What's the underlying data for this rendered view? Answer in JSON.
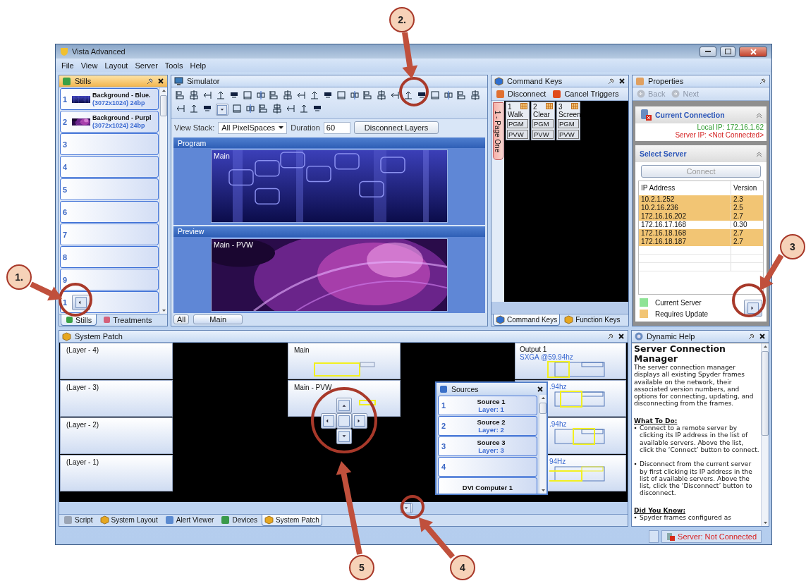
{
  "window": {
    "title": "Vista Advanced"
  },
  "menu": [
    "File",
    "View",
    "Layout",
    "Server",
    "Tools",
    "Help"
  ],
  "stills": {
    "title": "Stills",
    "items": [
      {
        "number": "1",
        "name": "Background - Blue.",
        "detail": "(3072x1024) 24bp"
      },
      {
        "number": "2",
        "name": "Background - Purpl",
        "detail": "(3072x1024) 24bp"
      },
      {
        "number": "3",
        "kind": "empty"
      },
      {
        "number": "4",
        "kind": "empty"
      },
      {
        "number": "5",
        "kind": "empty"
      },
      {
        "number": "6",
        "kind": "empty"
      },
      {
        "number": "7",
        "kind": "empty"
      },
      {
        "number": "8",
        "kind": "empty"
      },
      {
        "number": "9",
        "kind": "empty"
      },
      {
        "number": "1",
        "kind": "empty"
      }
    ],
    "tabs": [
      {
        "label": "Stills",
        "selected": true
      },
      {
        "label": "Treatments",
        "selected": false
      }
    ]
  },
  "simulator": {
    "title": "Simulator",
    "view_stack_label": "View Stack:",
    "view_stack": "All PixelSpaces",
    "duration_label": "Duration",
    "duration": "60",
    "disconnect_button": "Disconnect Layers",
    "sections": [
      {
        "title": "Program",
        "caption": "Main",
        "kind": "blue"
      },
      {
        "title": "Preview",
        "caption": "Main - PVW",
        "kind": "purple"
      }
    ],
    "filters": [
      {
        "label": "All",
        "selected": false
      },
      {
        "label": "Main",
        "selected": true
      }
    ]
  },
  "command_keys": {
    "title": "Command Keys",
    "toolbar": [
      "Disconnect",
      "Cancel Triggers"
    ],
    "page_tab": "1 - Page One",
    "keys": [
      {
        "number": "1",
        "name": "Walk",
        "buttons": [
          "PGM",
          "PVW"
        ]
      },
      {
        "number": "2",
        "name": "Clear",
        "buttons": [
          "PGM",
          "PVW"
        ]
      },
      {
        "number": "3",
        "name": "Screen",
        "buttons": [
          "PGM",
          "PVW"
        ]
      }
    ],
    "tabs": [
      {
        "label": "Command Keys",
        "selected": true
      },
      {
        "label": "Function Keys",
        "selected": false
      }
    ]
  },
  "properties": {
    "title": "Properties",
    "nav": [
      {
        "label": "Back",
        "disabled": true
      },
      {
        "label": "Next",
        "disabled": true
      }
    ],
    "current_connection": {
      "title": "Current Connection",
      "local_ip": "Local IP: 172.16.1.62",
      "server_ip": "Server IP: <Not Connected>"
    },
    "select_server": {
      "title": "Select Server",
      "connect": {
        "label": "Connect",
        "disabled": true
      },
      "columns": [
        "IP Address",
        "Version"
      ],
      "rows": [
        {
          "ip": "10.2.1.252",
          "version": "2.3",
          "requires_update": true
        },
        {
          "ip": "10.2.16.236",
          "version": "2.5",
          "requires_update": true
        },
        {
          "ip": "172.16.16.202",
          "version": "2.7",
          "requires_update": true
        },
        {
          "ip": "172.16.17.168",
          "version": "0.30",
          "requires_update": false
        },
        {
          "ip": "172.16.18.168",
          "version": "2.7",
          "requires_update": true
        },
        {
          "ip": "172.16.18.187",
          "version": "2.7",
          "requires_update": true
        }
      ],
      "legend": [
        {
          "label": "Current Server",
          "color": "#8fe396"
        },
        {
          "label": "Requires Update",
          "color": "#f2c574"
        }
      ]
    }
  },
  "system_patch": {
    "title": "System Patch",
    "layers": [
      "(Layer - 4)",
      "(Layer - 3)",
      "(Layer - 2)",
      "(Layer - 1)"
    ],
    "destinations": [
      "Main",
      "Main - PVW"
    ],
    "outputs": [
      {
        "name": "Output 1",
        "format": "SXGA @59.94hz"
      },
      {
        "format": ".94hz"
      },
      {
        "format": ".94hz"
      },
      {
        "format": "94Hz"
      }
    ],
    "sources_popup": {
      "title": "Sources",
      "items": [
        {
          "number": "1",
          "name": "Source 1",
          "layer": "Layer: 1"
        },
        {
          "number": "2",
          "name": "Source 2",
          "layer": "Layer: 2"
        },
        {
          "number": "3",
          "name": "Source 3",
          "layer": "Layer: 3"
        },
        {
          "number": "4"
        },
        {
          "name": "DVI Computer 1"
        }
      ]
    },
    "tabs": [
      {
        "label": "Script",
        "selected": false
      },
      {
        "label": "System Layout",
        "selected": false
      },
      {
        "label": "Alert Viewer",
        "selected": false
      },
      {
        "label": "Devices",
        "selected": false
      },
      {
        "label": "System Patch",
        "selected": true
      }
    ]
  },
  "dynamic_help": {
    "title": "Dynamic Help",
    "heading": "Server Connection Manager",
    "intro": "The server connection manager displays all existing Spyder frames available on the network, their associated version numbers, and options for connecting, updating, and disconnecting from the frames.",
    "sections": [
      {
        "heading": "What To Do:",
        "bullets": [
          "Connect to a remote server by clicking its IP address in the list of available servers.  Above the list, click the ‘Connect’ button to connect.",
          "Disconnect from the current server by first clicking its IP address in the list of available servers.  Above the list, click the ‘Disconnect’ button to disconnect."
        ]
      },
      {
        "heading": "Did You Know:",
        "bullets": [
          "Spyder frames configured as"
        ]
      }
    ]
  },
  "status_bar": {
    "server_status": "Server: Not Connected"
  },
  "annotations": [
    {
      "label": "1."
    },
    {
      "label": "2."
    },
    {
      "label": "3"
    },
    {
      "label": "4"
    },
    {
      "label": "5"
    }
  ]
}
